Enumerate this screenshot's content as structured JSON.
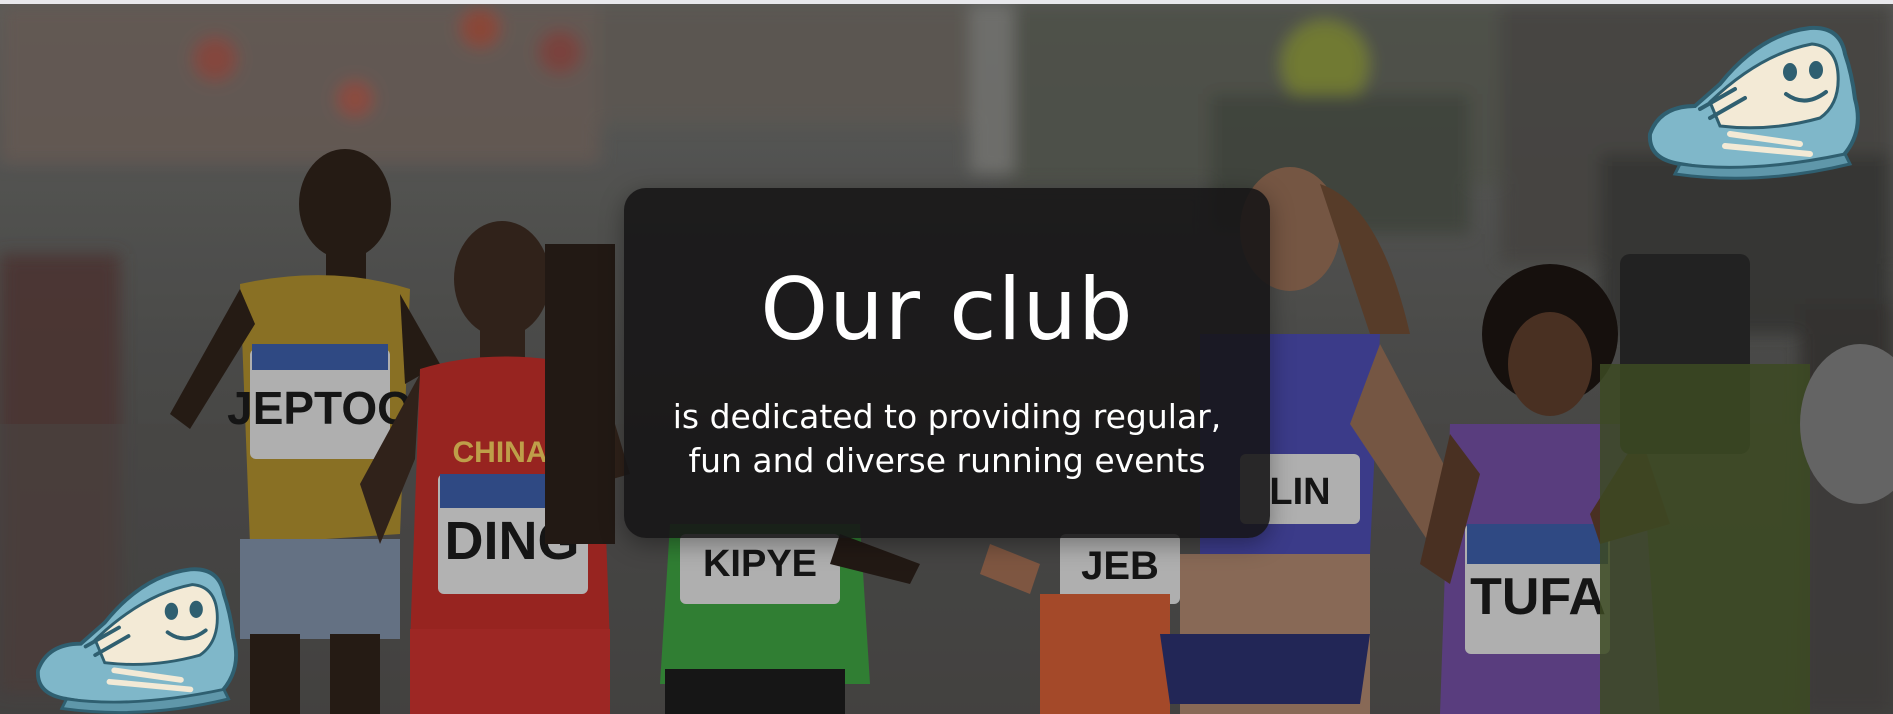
{
  "hero": {
    "image": "Marathon runners photo background",
    "bibs": [
      "JEPTOO",
      "DING",
      "KIPYE",
      "JEB",
      "LIN",
      "TUFA"
    ],
    "team_label": "CHINA"
  },
  "overlay": {
    "title": "Our club",
    "line1": "is dedicated to providing regular,",
    "line2": "fun and diverse running events"
  },
  "colors": {
    "card": "#161416",
    "text": "#ffffff",
    "shoe_blue": "#7fb7c9",
    "shoe_cream": "#f3ead6"
  },
  "icons": [
    "cartoon-sneaker-icon-top-right",
    "cartoon-sneaker-icon-bottom-left"
  ]
}
